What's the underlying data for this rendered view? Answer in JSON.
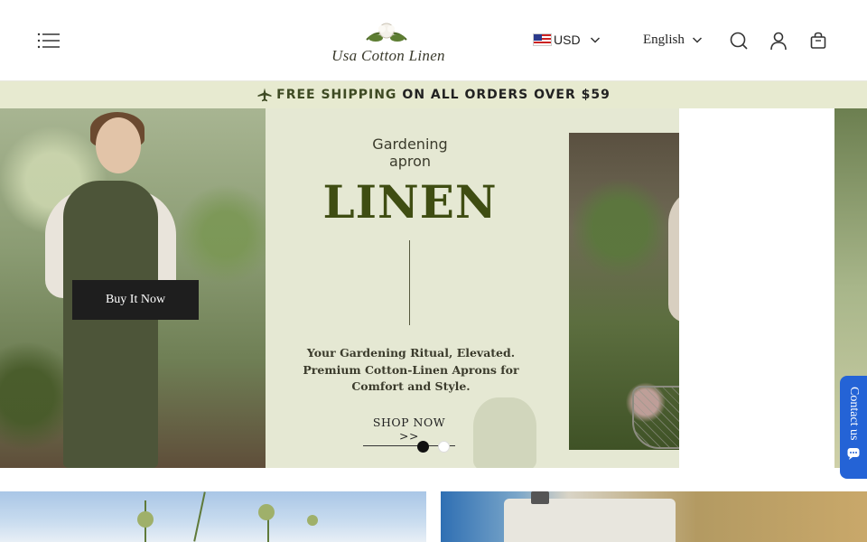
{
  "header": {
    "logo_text": "Usa Cotton Linen",
    "currency": {
      "code": "USD"
    },
    "language": {
      "label": "English"
    }
  },
  "announcement": {
    "highlight": "FREE SHIPPING",
    "rest": "ON ALL ORDERS OVER $59"
  },
  "hero": {
    "buy_button": "Buy It Now",
    "subtitle_line1": "Gardening",
    "subtitle_line2": "apron",
    "title": "LINEN",
    "tagline_line1": "Your Gardening Ritual, Elevated.",
    "tagline_line2": "Premium Cotton-Linen Aprons for",
    "tagline_line3": "Comfort and Style.",
    "cta": "SHOP NOW >>",
    "slides": {
      "total": 2,
      "active_index": 0
    }
  },
  "contact": {
    "label": "Contact us"
  },
  "colors": {
    "title_green": "#3f4d12",
    "announce_bg": "#e7ead0",
    "contact_blue": "#2463d6"
  },
  "icons": [
    "menu-icon",
    "search-icon",
    "account-icon",
    "cart-icon",
    "chevron-down-icon",
    "plane-icon",
    "chat-icon"
  ]
}
